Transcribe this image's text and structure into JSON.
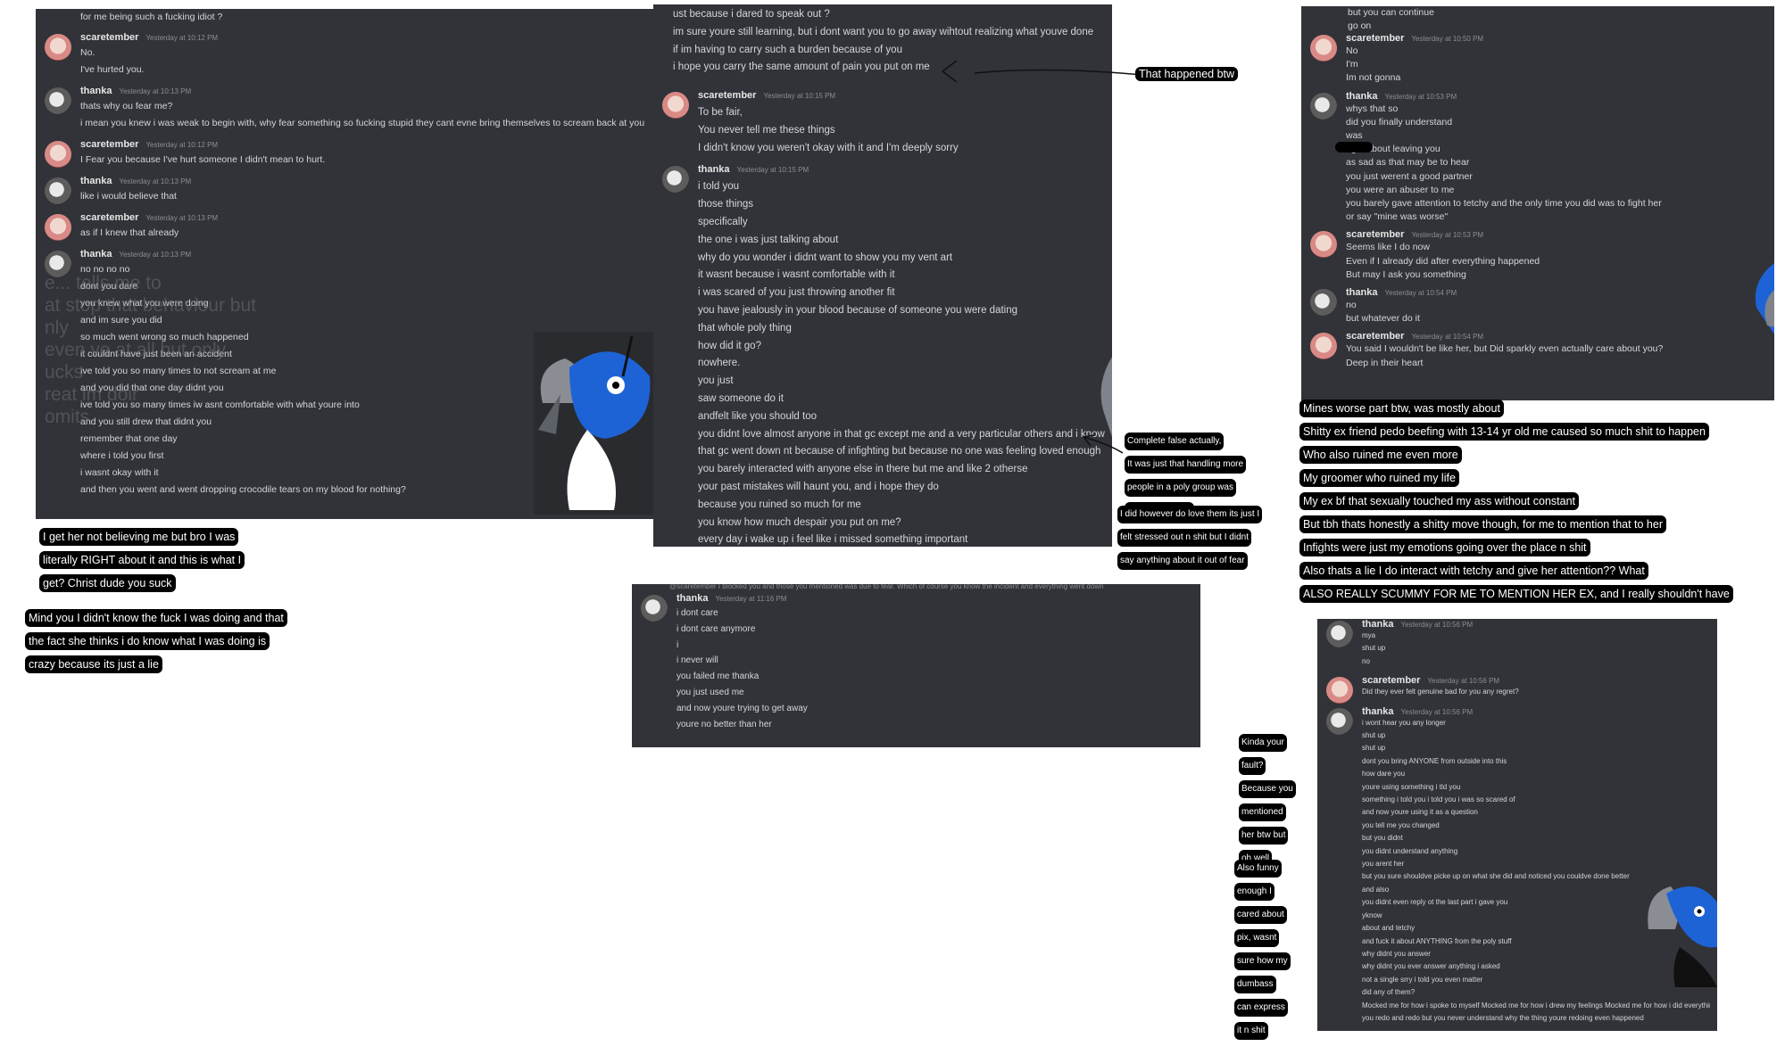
{
  "s1": {
    "top_line": "for me being such a fucking idiot ?",
    "messages": [
      {
        "user": "scaretember",
        "ts": "Yesterday at 10:12 PM",
        "lines": [
          "No.",
          "I've hurted you."
        ]
      },
      {
        "user": "thanka",
        "ts": "Yesterday at 10:13 PM",
        "lines": [
          "thats why ou fear me?",
          "i mean you knew i was weak to begin with, why fear something so fucking stupid they cant evne bring themselves to scream back at you"
        ]
      },
      {
        "user": "scaretember",
        "ts": "Yesterday at 10:12 PM",
        "lines": [
          "I Fear you because I've hurt someone I didn't mean to hurt."
        ]
      },
      {
        "user": "thanka",
        "ts": "Yesterday at 10:13 PM",
        "lines": [
          "like i would believe that"
        ]
      },
      {
        "user": "scaretember",
        "ts": "Yesterday at 10:13 PM",
        "lines": [
          "as if I knew that already"
        ]
      },
      {
        "user": "thanka",
        "ts": "Yesterday at 10:13 PM",
        "lines": [
          "no no no no",
          "dont you dare",
          "you knew what you were doing",
          "and im sure you did",
          "so much went wrong so much happened",
          "it couldnt have just been an accident",
          "ive told you so many times to not scream at me",
          "and you did that one day didnt you",
          "ive told you so many times iw asnt comfortable with what youre into",
          "and you still drew that didnt you",
          "remember that one day",
          "where i told you first",
          "i wasnt okay with it",
          "and then you went and went dropping crocodile tears on my blood for nothing?"
        ]
      }
    ]
  },
  "s2": {
    "top_lines": [
      "ust because i dared to speak out ?",
      "im sure youre still learning, but i dont want you to go away wihtout realizing what youve done",
      "if im having to carry such a burden because of you",
      "i hope you carry the same amount of pain you put on me"
    ],
    "messages": [
      {
        "user": "scaretember",
        "ts": "Yesterday at 10:15 PM",
        "lines": [
          "To be fair,",
          "You never tell me these things",
          "I didn't know you weren't okay with it and I'm deeply sorry"
        ]
      },
      {
        "user": "thanka",
        "ts": "Yesterday at 10:15 PM",
        "lines": [
          "i told you",
          "those things",
          "specifically",
          "the one i was just talking about",
          "why do you wonder i didnt want to show you my vent art",
          "it wasnt because i wasnt comfortable with it",
          "i was scared of you just throwing another fit",
          "you have jealously in your blood because of someone you were dating",
          "that whole poly thing",
          "how did it go?",
          "nowhere.",
          "you just",
          "saw someone do it",
          "andfelt like you should too",
          "you didnt love almost anyone in that gc except me and a very particular others and i know it",
          "that gc went down nt because of infighting but because no one was feeling loved enough",
          "you barely interacted with anyone else in there but me and like 2 otherse",
          "your past mistakes will haunt you, and i hope they do",
          "because you ruined so much for me",
          "you know how much despair you put on me?",
          "every day i wake up i feel like i missed something important"
        ]
      }
    ]
  },
  "s3": {
    "top_line": "but you can continue",
    "top_line2": "go on",
    "messages": [
      {
        "user": "scaretember",
        "ts": "Yesterday at 10:50 PM",
        "lines": [
          "No",
          "I'm",
          "Im not gonna"
        ]
      },
      {
        "user": "thanka",
        "ts": "Yesterday at 10:53 PM",
        "lines": [
          "whys that so",
          "did you finally understand",
          "       was",
          "right about leaving you",
          "as sad as that may be to hear",
          "you just werent a good partner",
          "you were an abuser to me",
          "you barely gave attention to tetchy and the only time you did was to fight her",
          "or say \"mine was worse\""
        ]
      },
      {
        "user": "scaretember",
        "ts": "Yesterday at 10:53 PM",
        "lines": [
          "Seems like I do now",
          "Even if I already did after everything happened",
          "But may I ask you something"
        ]
      },
      {
        "user": "thanka",
        "ts": "Yesterday at 10:54 PM",
        "lines": [
          "no",
          "but whatever do it"
        ]
      },
      {
        "user": "scaretember",
        "ts": "Yesterday at 10:54 PM",
        "lines": [
          "You said I wouldn't be like her, but Did sparkly even actually care about you?",
          "Deep in their heart"
        ]
      }
    ]
  },
  "s4": {
    "top_line": "@scaretember I blocked you and those you mentioned was due to fear. Which of course you know the incident and everything went down",
    "messages": [
      {
        "user": "thanka",
        "ts": "Yesterday at 11:16 PM",
        "lines": [
          "i dont care",
          "i dont care anymore",
          "i",
          "i never will",
          "you failed me thanka",
          "you just used me",
          "and now youre trying to get away",
          "youre no better than her"
        ]
      }
    ]
  },
  "s5": {
    "messages": [
      {
        "user": "thanka",
        "ts": "Yesterday at 10:56 PM",
        "lines": [
          "mya",
          "shut up",
          "no"
        ]
      },
      {
        "user": "scaretember",
        "ts": "Yesterday at 10:56 PM",
        "lines": [
          "Did they ever felt genuine bad for you any regret?"
        ]
      },
      {
        "user": "thanka",
        "ts": "Yesterday at 10:56 PM",
        "lines": [
          "i wont hear you any longer",
          "shut up",
          "shut up",
          "dont you bring ANYONE from outside into this",
          "how dare you",
          "youre using something i tld you",
          "something i told you i told you i was so scared of",
          "and now youre using it as a question",
          "you tell me you changed",
          "but you didnt",
          "you didnt understand anything",
          "you arent her",
          "but you sure shouldve picke up on what she did and noticed you couldve done better",
          "and also",
          "you didnt even reply ot the last part i gave you",
          "yknow",
          "about      and tetchy",
          "and fuck it about ANYTHING from the poly stuff",
          "why didnt you answer",
          "why didnt you ever answer anything i asked",
          "not a single srry i told you even matter",
          "did any of them?",
          "Mocked me for how i spoke to myself Mocked me for how i drew my feelings Mocked me for how i did everything",
          "you redo and redo but you never understand why the thing youre redoing even happened"
        ]
      }
    ]
  },
  "notes": {
    "n1": [
      "I get her not believing me but bro I was",
      "literally RIGHT about it and this is what I",
      "get? Christ dude you suck"
    ],
    "n2": [
      "Mind you I didn't know the fuck I was doing and that",
      "the fact she thinks i do know what I was doing is",
      "crazy because its just a lie"
    ],
    "happened": "That happened btw",
    "n3": [
      "Complete false actually,",
      "It was just that handling more",
      "people in a poly group was",
      "too much for me"
    ],
    "n4": [
      "I did however do love them its just I",
      "felt stressed out n shit but I didnt",
      "say anything about it out of fear"
    ],
    "n5": [
      "Mines worse part btw, was mostly about",
      "Shitty ex friend pedo beefing with 13-14 yr old me caused so much shit to happen",
      "Who also ruined me even more",
      "My groomer who ruined my life",
      "My ex bf that sexually touched my ass without constant",
      "But tbh thats honestly a shitty move though, for me to mention that to her",
      "Infights were just my emotions going over the place n shit",
      "Also thats a lie I do interact with tetchy and give her attention?? What",
      "ALSO REALLY SCUMMY FOR ME TO MENTION HER EX, and I really shouldn't have"
    ],
    "n6": [
      "Kinda your",
      "fault?",
      "Because you",
      "mentioned",
      "her btw but",
      "oh well"
    ],
    "n7": [
      "Also funny",
      "enough I",
      "cared about",
      "pix, wasnt",
      "sure how my",
      "dumbass",
      "can express",
      "it n shit"
    ]
  },
  "faint_overlay": [
    "e... tells me to",
    "at stop that behaviour but",
    "nly",
    "even   ve at all but only",
    "ucks",
    "reat               im doir",
    "omits"
  ],
  "colors": {
    "panel": "#313338",
    "text": "#d4d6da",
    "note_bg": "#000000",
    "note_text": "#ffffff",
    "mascot_blue": "#1e63d6"
  }
}
